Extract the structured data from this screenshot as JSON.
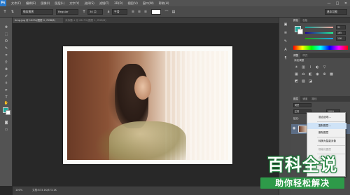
{
  "app": {
    "logo": "Ps",
    "menu": [
      "文件(F)",
      "编辑(E)",
      "图像(I)",
      "图层(L)",
      "文字(Y)",
      "选择(S)",
      "滤镜(T)",
      "3D(D)",
      "视图(V)",
      "窗口(W)",
      "帮助(H)"
    ],
    "window_controls": [
      "—",
      "□",
      "✕"
    ],
    "brand_color": "#2a7ccf"
  },
  "options": {
    "font_family": "微软雅黑",
    "font_style": "Regular",
    "font_size": "30 点",
    "antialias": "平滑",
    "workspace": "基本功能"
  },
  "tabs": [
    {
      "label": "timg.jpg @ 100%(图层 0, RGB/8)"
    },
    {
      "label": "未标题-1 @ 66.7%(图层 1, RGB/8)"
    }
  ],
  "toolbar": {
    "foreground_color": "#1fa89c",
    "background_color": "#ffffff"
  },
  "status": {
    "zoom": "100%",
    "doc_info": "文档:873.1K/873.1K"
  },
  "panels": {
    "color_tabs": [
      "颜色",
      "色板"
    ],
    "sliders": [
      {
        "channel": "R",
        "value": "31"
      },
      {
        "channel": "G",
        "value": "165"
      },
      {
        "channel": "B",
        "value": "156"
      }
    ],
    "adjust_tabs": [
      "调整",
      "样式"
    ],
    "adjust_label": "添加调整",
    "layer_tabs": [
      "图层",
      "通道",
      "路径"
    ],
    "layer_kind": "类型",
    "blend_mode": "正常",
    "opacity": "100%",
    "lock_label": "锁定:",
    "fill": "100%",
    "layer_name": "图层 0"
  },
  "context_menu": {
    "items": [
      {
        "label": "混合选项...",
        "disabled": false
      },
      {
        "label": "复制图层...",
        "disabled": false,
        "highlight": true
      },
      {
        "label": "删除图层",
        "disabled": false
      },
      {
        "label": "转换为智能对象",
        "disabled": false
      },
      {
        "label": "栅格化图层",
        "disabled": true
      },
      {
        "label": "合并图层",
        "disabled": true
      },
      {
        "label": "合并可见图层",
        "disabled": false
      }
    ]
  },
  "watermark": {
    "title": "百科全说",
    "subtitle": "助你轻松解决",
    "color": "#2e9a49"
  }
}
